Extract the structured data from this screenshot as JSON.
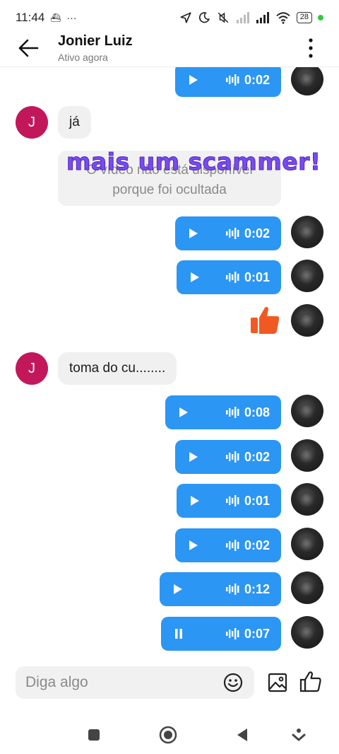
{
  "status_bar": {
    "time": "11:44",
    "battery": "28"
  },
  "header": {
    "contact_name": "Jonier Luiz",
    "contact_status": "Ativo agora"
  },
  "messages": {
    "audio_1": "0:02",
    "in_1_initial": "J",
    "in_1_text": "já",
    "notice_line1": "O vídeo não está disponível",
    "notice_line2": "porque foi ocultada",
    "overlay": "mais um scammer!",
    "audio_2": "0:02",
    "audio_3": "0:01",
    "in_2_initial": "J",
    "in_2_text": "toma do cu........",
    "audio_4": "0:08",
    "audio_5": "0:02",
    "audio_6": "0:01",
    "audio_7": "0:02",
    "audio_8": "0:12",
    "audio_9": "0:07"
  },
  "composer": {
    "placeholder": "Diga algo"
  },
  "colors": {
    "accent": "#2b96f3",
    "avatar_j": "#c2185b",
    "thumb": "#f05a22",
    "overlay": "#7a4af0"
  }
}
